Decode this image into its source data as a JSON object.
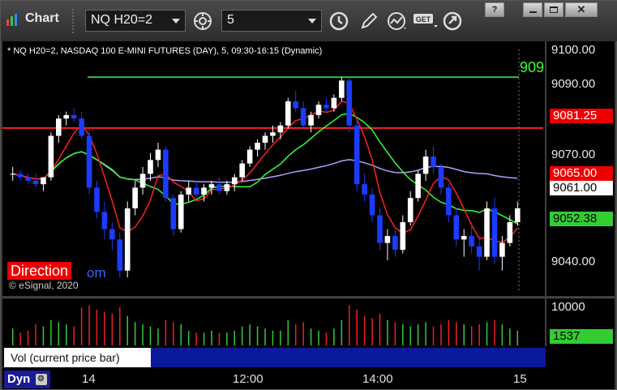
{
  "window": {
    "title": "Chart",
    "symbol": "NQ H20=2",
    "interval": "5"
  },
  "chart": {
    "header": "* NQ H20=2, NASDAQ 100 E-MINI FUTURES (DAY), 5, 09:30-16:15 (Dynamic)",
    "watermark": "© eSignal, 2020",
    "direction_label": "Direction",
    "om_text": "om",
    "cut_label": "909",
    "price_ticks": [
      "9100.00",
      "9090.00",
      "9070.00",
      "9040.00"
    ],
    "price_tags": {
      "red_line": "9081.25",
      "red_ma": "9065.00",
      "last_price": "9061.00",
      "green_ma": "9052.38"
    },
    "colors": {
      "up": "#ffffff",
      "down": "#1a3cff",
      "red_line": "#ff2020",
      "green_line": "#33ff33",
      "purple_ma": "#b59cff"
    }
  },
  "volume": {
    "tick": "10000",
    "last_tag": "1537"
  },
  "study": {
    "label": "Vol (current price bar)",
    "close": "×"
  },
  "time_axis": {
    "dyn": "Dyn",
    "labels": [
      "14",
      "12:00",
      "14:00",
      "15"
    ]
  },
  "chart_data": {
    "type": "candlestick",
    "y_range": [
      9035,
      9104
    ],
    "candles": [
      [
        9068,
        9070,
        9066,
        9068
      ],
      [
        9068,
        9069,
        9066,
        9067
      ],
      [
        9067,
        9068,
        9065,
        9066
      ],
      [
        9066,
        9068,
        9064,
        9065
      ],
      [
        9065,
        9067,
        9063,
        9067
      ],
      [
        9067,
        9080,
        9066,
        9079
      ],
      [
        9079,
        9085,
        9077,
        9084
      ],
      [
        9084,
        9086,
        9082,
        9085
      ],
      [
        9085,
        9087,
        9083,
        9084
      ],
      [
        9084,
        9086,
        9078,
        9079
      ],
      [
        9079,
        9081,
        9062,
        9064
      ],
      [
        9064,
        9066,
        9055,
        9057
      ],
      [
        9057,
        9060,
        9049,
        9052
      ],
      [
        9052,
        9054,
        9046,
        9049
      ],
      [
        9049,
        9051,
        9038,
        9040
      ],
      [
        9040,
        9060,
        9038,
        9058
      ],
      [
        9058,
        9066,
        9056,
        9064
      ],
      [
        9064,
        9070,
        9062,
        9068
      ],
      [
        9068,
        9074,
        9066,
        9072
      ],
      [
        9072,
        9077,
        9070,
        9075
      ],
      [
        9075,
        9076,
        9060,
        9061
      ],
      [
        9061,
        9062,
        9050,
        9052
      ],
      [
        9052,
        9063,
        9051,
        9062
      ],
      [
        9062,
        9066,
        9060,
        9064
      ],
      [
        9064,
        9066,
        9061,
        9062
      ],
      [
        9062,
        9065,
        9060,
        9064
      ],
      [
        9064,
        9066,
        9062,
        9065
      ],
      [
        9065,
        9067,
        9062,
        9063
      ],
      [
        9063,
        9066,
        9062,
        9065
      ],
      [
        9065,
        9068,
        9063,
        9067
      ],
      [
        9067,
        9072,
        9066,
        9071
      ],
      [
        9071,
        9076,
        9070,
        9075
      ],
      [
        9075,
        9078,
        9073,
        9077
      ],
      [
        9077,
        9080,
        9075,
        9079
      ],
      [
        9079,
        9082,
        9077,
        9080
      ],
      [
        9080,
        9083,
        9078,
        9082
      ],
      [
        9082,
        9090,
        9081,
        9089
      ],
      [
        9089,
        9092,
        9086,
        9087
      ],
      [
        9087,
        9089,
        9081,
        9082
      ],
      [
        9082,
        9086,
        9080,
        9085
      ],
      [
        9085,
        9089,
        9084,
        9088
      ],
      [
        9088,
        9090,
        9086,
        9087
      ],
      [
        9087,
        9091,
        9086,
        9090
      ],
      [
        9090,
        9096,
        9089,
        9095
      ],
      [
        9095,
        9096,
        9080,
        9082
      ],
      [
        9082,
        9084,
        9063,
        9065
      ],
      [
        9065,
        9068,
        9060,
        9062
      ],
      [
        9062,
        9064,
        9054,
        9056
      ],
      [
        9056,
        9058,
        9046,
        9048
      ],
      [
        9048,
        9052,
        9043,
        9050
      ],
      [
        9050,
        9052,
        9044,
        9046
      ],
      [
        9046,
        9056,
        9045,
        9054
      ],
      [
        9054,
        9063,
        9053,
        9061
      ],
      [
        9061,
        9069,
        9060,
        9068
      ],
      [
        9068,
        9075,
        9066,
        9073
      ],
      [
        9073,
        9076,
        9068,
        9070
      ],
      [
        9070,
        9071,
        9062,
        9064
      ],
      [
        9064,
        9065,
        9054,
        9056
      ],
      [
        9056,
        9058,
        9047,
        9049
      ],
      [
        9049,
        9052,
        9044,
        9050
      ],
      [
        9050,
        9054,
        9045,
        9047
      ],
      [
        9047,
        9050,
        9040,
        9044
      ],
      [
        9044,
        9060,
        9043,
        9058
      ],
      [
        9058,
        9061,
        9042,
        9044
      ],
      [
        9044,
        9050,
        9040,
        9048
      ],
      [
        9048,
        9056,
        9047,
        9054
      ],
      [
        9054,
        9060,
        9053,
        9058
      ]
    ],
    "volumes": [
      0.4,
      0.3,
      0.35,
      0.5,
      0.45,
      0.6,
      0.55,
      0.5,
      0.45,
      0.9,
      0.95,
      0.85,
      0.8,
      0.75,
      0.9,
      0.7,
      0.55,
      0.5,
      0.45,
      0.4,
      0.6,
      0.55,
      0.5,
      0.35,
      0.3,
      0.3,
      0.35,
      0.3,
      0.3,
      0.35,
      0.45,
      0.5,
      0.45,
      0.4,
      0.35,
      0.35,
      0.6,
      0.5,
      0.55,
      0.4,
      0.35,
      0.3,
      0.4,
      0.6,
      0.95,
      0.85,
      0.7,
      0.65,
      0.75,
      0.6,
      0.55,
      0.5,
      0.45,
      0.5,
      0.55,
      0.45,
      0.5,
      0.6,
      0.55,
      0.5,
      0.45,
      0.5,
      0.55,
      0.6,
      0.5,
      0.4,
      0.35
    ]
  }
}
